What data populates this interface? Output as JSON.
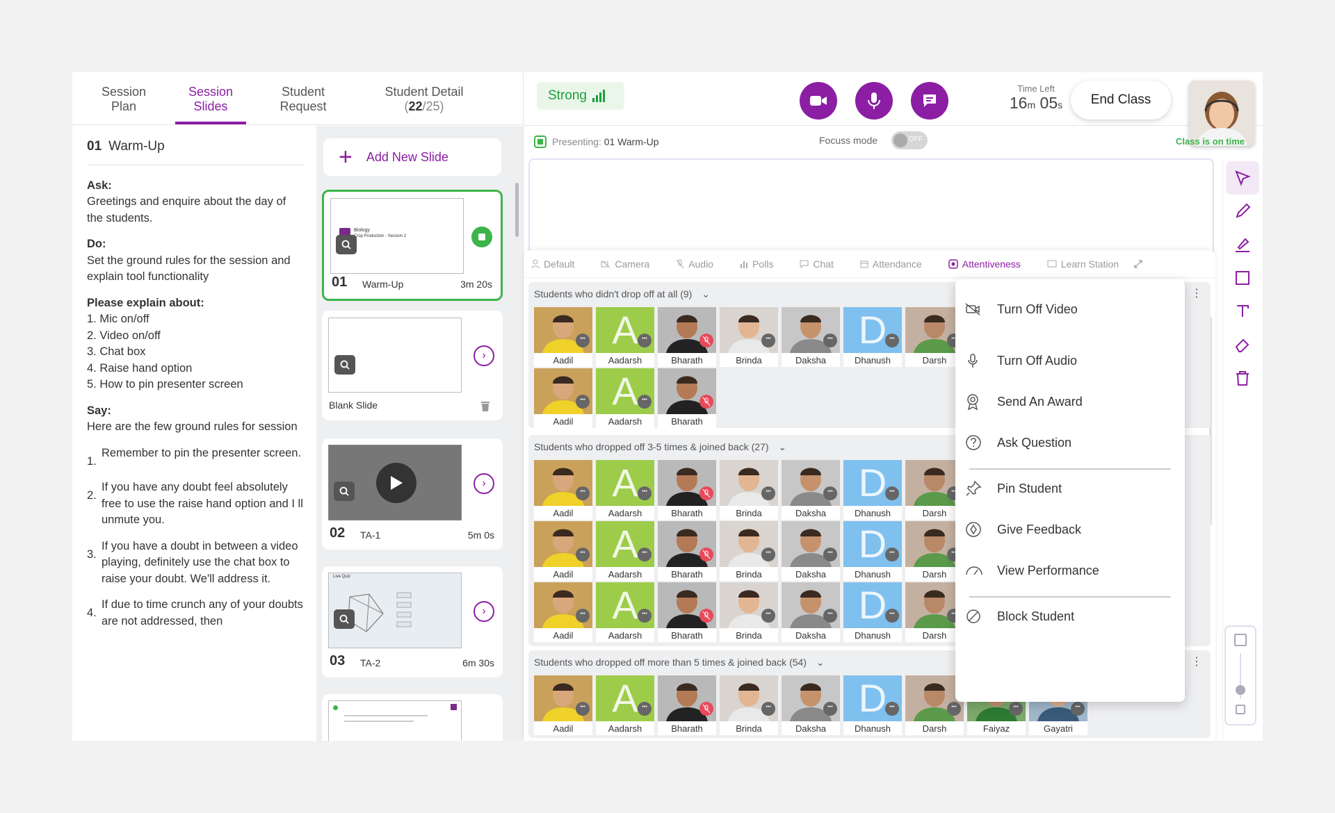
{
  "tabs": [
    {
      "label": "Session\nPlan"
    },
    {
      "label": "Session\nSlides"
    },
    {
      "label": "Student\nRequest"
    },
    {
      "label": "Student Detail",
      "count": "22",
      "total": "/25)",
      "open": "("
    }
  ],
  "notes": {
    "num": "01",
    "title": "Warm-Up",
    "ask_label": "Ask:",
    "ask": "Greetings and enquire about the day of the students.",
    "do_label": "Do:",
    "do": "Set the ground rules for the session and explain tool functionality",
    "explain_label": "Please explain about:",
    "explain": [
      "1. Mic on/off",
      "2. Video on/off",
      "3. Chat box",
      "4. Raise hand option",
      "5. How to pin presenter screen"
    ],
    "say_label": "Say:",
    "say": "Here are the few ground rules for session",
    "rules": [
      {
        "n": "1.",
        "t": "Remember to pin the presenter screen."
      },
      {
        "n": "2.",
        "t": "If you have any doubt feel absolutely free to use the raise hand option and I ll unmute you."
      },
      {
        "n": "3.",
        "t": "If you have a doubt in between a video playing, definitely use the chat box to raise your doubt. We'll address it."
      },
      {
        "n": "4.",
        "t": "If due to time crunch any of your doubts are not addressed, then"
      }
    ]
  },
  "slides": {
    "add_label": "Add New Slide",
    "items": [
      {
        "num": "01",
        "title": "Warm-Up",
        "duration": "3m 20s",
        "thumb_title": "Biology",
        "thumb_sub": "Crop Production - Session 2"
      },
      {
        "num": "",
        "title": "Blank Slide",
        "duration": ""
      },
      {
        "num": "02",
        "title": "TA-1",
        "duration": "5m 0s"
      },
      {
        "num": "03",
        "title": "TA-2",
        "duration": "6m 30s",
        "thumb_title": "Live Quiz"
      }
    ]
  },
  "header": {
    "network": "Strong",
    "time_left_label": "Time Left",
    "time_m": "16",
    "time_m_unit": "m",
    "time_s": "05",
    "time_s_unit": "s",
    "end_class": "End Class"
  },
  "presenting": {
    "label": "Presenting:",
    "value": "01 Warm-Up",
    "focus_label": "Focuss mode",
    "focus_state": "OFF",
    "status": "Class is on time"
  },
  "panel_tabs": [
    "Default",
    "Camera",
    "Audio",
    "Polls",
    "Chat",
    "Attendance",
    "Attentiveness",
    "Learn Station"
  ],
  "groups": [
    {
      "title": "Students who didn't drop off at all (9)"
    },
    {
      "title": "Students who dropped off 3-5 times & joined back (27)"
    },
    {
      "title": "Students who dropped off more than 5 times & joined back (54)"
    }
  ],
  "students": [
    "Aadil",
    "Aadarsh",
    "Bharath",
    "Brinda",
    "Daksha",
    "Dhanush",
    "Darsh",
    "Faiyaz",
    "Gayatri"
  ],
  "menu": [
    "Turn Off Video",
    "Turn Off Audio",
    "Send An Award",
    "Ask Question",
    "Pin Student",
    "Give Feedback",
    "View Performance",
    "Block Student"
  ],
  "colors": {
    "accent": "#8b1ea3",
    "success": "#3cb44a",
    "mute": "#e74a5a"
  }
}
